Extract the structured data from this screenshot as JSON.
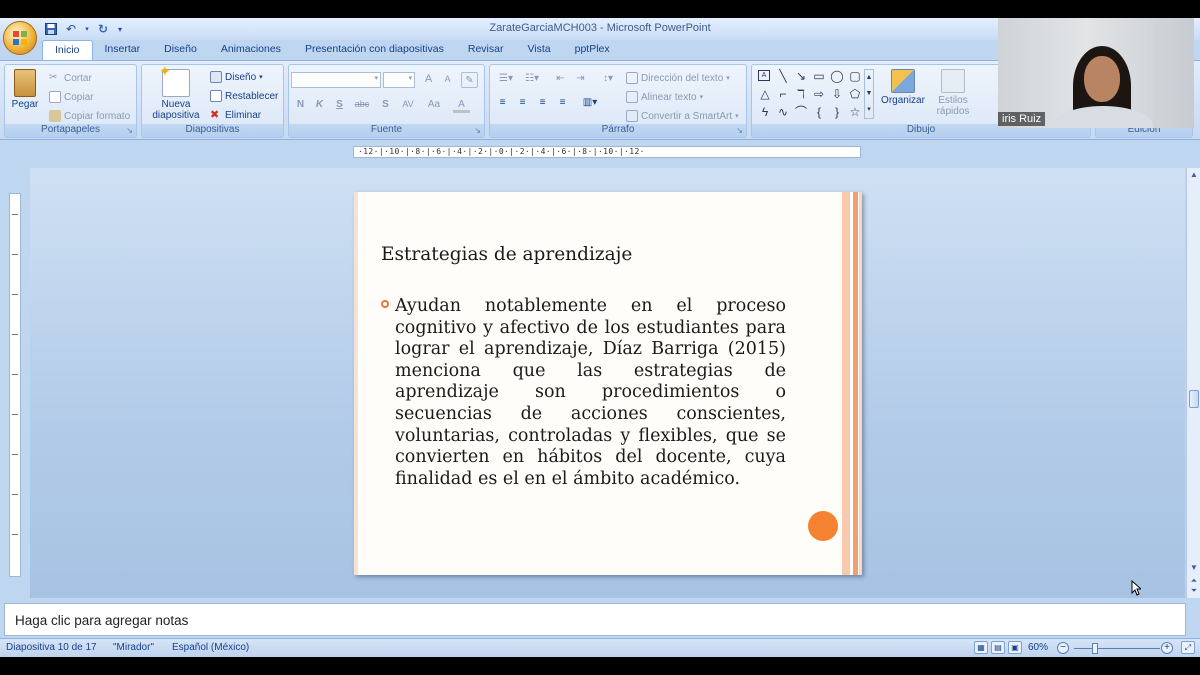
{
  "window": {
    "title": "ZarateGarciaMCH003 - Microsoft PowerPoint"
  },
  "tabs": [
    "Inicio",
    "Insertar",
    "Diseño",
    "Animaciones",
    "Presentación con diapositivas",
    "Revisar",
    "Vista",
    "pptPlex"
  ],
  "active_tab": "Inicio",
  "ribbon": {
    "portapapeles": {
      "label": "Portapapeles",
      "paste": "Pegar",
      "cut": "Cortar",
      "copy": "Copiar",
      "format_painter": "Copiar formato"
    },
    "diapositivas": {
      "label": "Diapositivas",
      "new_slide": "Nueva diapositiva",
      "layout": "Diseño",
      "reset": "Restablecer",
      "delete": "Eliminar"
    },
    "fuente": {
      "label": "Fuente",
      "font_name": "",
      "font_size": "",
      "bold": "N",
      "italic": "K",
      "underline": "S",
      "strike": "abc",
      "shadow": "S",
      "spacing": "AV",
      "case": "Aa",
      "color": "A",
      "grow": "A",
      "shrink": "A"
    },
    "parrafo": {
      "label": "Párrafo",
      "text_direction": "Dirección del texto",
      "align_text": "Alinear texto",
      "smartart": "Convertir a SmartArt"
    },
    "dibujo": {
      "label": "Dibujo",
      "arrange": "Organizar",
      "quick_styles": "Estilos rápidos"
    },
    "edicion": {
      "label": "Edición"
    }
  },
  "ruler_top": "·12·|·10·|·8·|·6·|·4·|·2·|·0·|·2·|·4·|·6·|·8·|·10·|·12·",
  "slide": {
    "title": "Estrategias de aprendizaje",
    "body": "Ayudan notablemente en el proceso cognitivo y afectivo de los estudiantes para lograr el aprendizaje, Díaz Barriga (2015) menciona que las estrategias de aprendizaje son procedimientos o secuencias de acciones conscientes, voluntarias, controladas y flexibles, que se convierten en hábitos del docente, cuya finalidad es el en el ámbito académico."
  },
  "notes": {
    "placeholder": "Haga clic para agregar notas"
  },
  "status": {
    "slide_counter": "Diapositiva 10 de 17",
    "theme": "\"Mirador\"",
    "language": "Español (México)",
    "zoom": "60%"
  },
  "webcam": {
    "name": "iris Ruiz"
  },
  "colors": {
    "accent_orange": "#f58231",
    "ribbon_blue": "#15428b"
  }
}
